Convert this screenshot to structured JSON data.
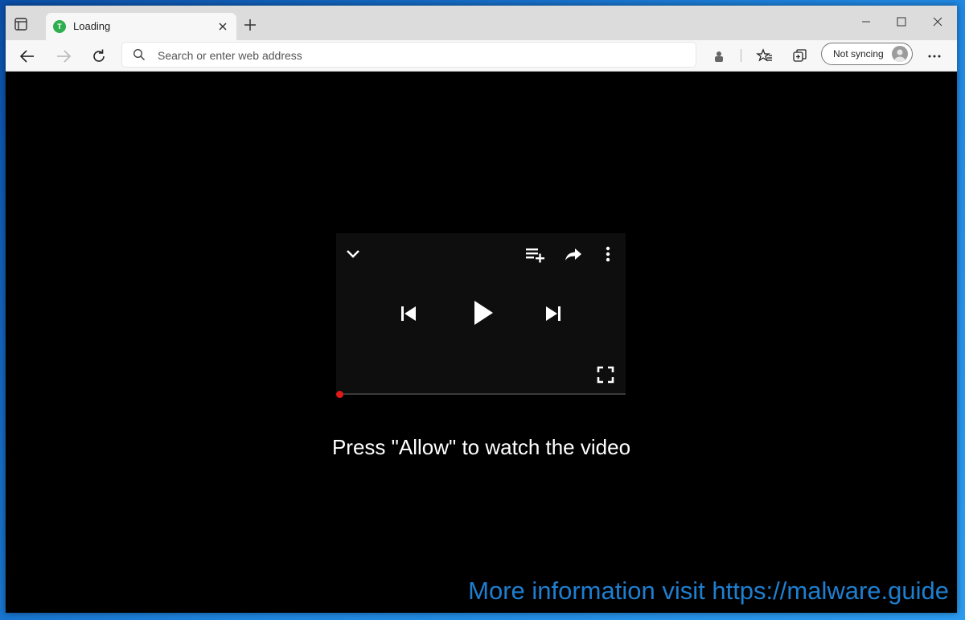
{
  "browser": {
    "tab": {
      "title": "Loading",
      "favicon_letter": "T"
    },
    "address_bar": {
      "placeholder": "Search or enter web address",
      "value": ""
    },
    "profile": {
      "label": "Not syncing"
    }
  },
  "page": {
    "prompt": "Press \"Allow\" to watch the video",
    "player": {
      "progress": 0
    }
  },
  "watermark": {
    "text": "More information visit https://malware.guide"
  },
  "colors": {
    "progress_dot": "#e01a1a",
    "watermark": "#1e7fd1",
    "favicon": "#2eae4e"
  },
  "icons": {
    "tab_actions": "tab-actions-icon",
    "close": "close-icon",
    "new_tab": "plus-icon",
    "minimize": "minimize-icon",
    "maximize": "maximize-icon",
    "window_close": "window-close-icon",
    "back": "back-arrow-icon",
    "forward": "forward-arrow-icon",
    "refresh": "refresh-icon",
    "search": "search-icon",
    "extension": "puzzle-extension-icon",
    "favorites": "favorites-star-icon",
    "collections": "collections-icon",
    "more": "more-dots-icon",
    "player_collapse": "chevron-down-icon",
    "add_to_queue": "playlist-add-icon",
    "share": "share-icon",
    "player_menu": "vertical-dots-icon",
    "previous": "skip-previous-icon",
    "play": "play-icon",
    "next": "skip-next-icon",
    "fullscreen": "fullscreen-icon"
  }
}
